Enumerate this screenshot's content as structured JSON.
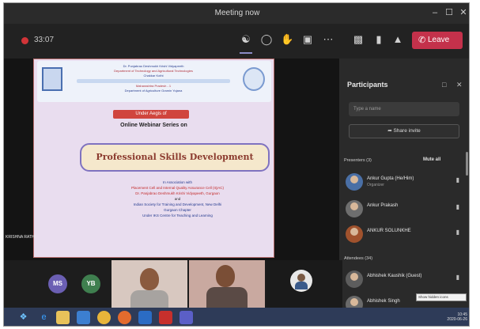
{
  "window": {
    "title": "Meeting now",
    "controls": [
      "–",
      "☐",
      "✕"
    ]
  },
  "toolbar": {
    "timer": "33:07",
    "icons": [
      "people-icon",
      "chat-icon",
      "raise-hand-icon",
      "rooms-icon",
      "more-icon",
      "camera-icon",
      "mic-icon",
      "share-icon"
    ],
    "leave_label": "Leave"
  },
  "slide": {
    "header_lines": [
      "Dr. Punjabrao Deshmukh Krishi Vidyapeeth",
      "Department of Technology and Agricultural Technologies",
      "Chakkar Kothi",
      "Maharashtra Pradesh - 1",
      "Department of Agriculture Gramin Yojana"
    ],
    "banner": "Under Aegis of",
    "series_title": "Online Webinar Series on",
    "main_title": "Professional Skills Development",
    "assoc_lines": [
      "In Association with",
      "Placement Cell and Internal Quality Assurance Cell (IQAC)",
      "Dr. Panjabrao Deshmukh Krishi Vidyapeeth, Gurgaon",
      "and",
      "Indian Society for Training and Development, New Delhi",
      "Gurgaon Chapter",
      "Under IKS Centre for Teaching and Learning"
    ],
    "speaker_label": "KRISHNA RATHI"
  },
  "participants": {
    "title": "Participants",
    "invite_placeholder": "Type a name",
    "share_invite_label": "Share invite",
    "presenters_section": "Presenters (3)",
    "mute_all_label": "Mute all",
    "attendees_section": "Attendees (34)",
    "people": [
      {
        "name": "Ankur Gupta (He/Him)",
        "role": "Organizer"
      },
      {
        "name": "Ankur Prakash",
        "role": ""
      },
      {
        "name": "ANKUR SOLUNKHE",
        "role": ""
      },
      {
        "name": "Abhishek Kaushik (Guest)",
        "role": ""
      },
      {
        "name": "Abhishek Singh",
        "role": ""
      }
    ]
  },
  "strip": {
    "avatars": [
      {
        "initials": "MS",
        "color": "#6b5fb3"
      },
      {
        "initials": "YB",
        "color": "#3f7f4f"
      }
    ]
  },
  "taskbar": {
    "apps": [
      "start-icon",
      "ie-icon",
      "explorer-icon",
      "store-icon",
      "chrome-icon",
      "firefox-icon",
      "outlook-icon",
      "acrobat-icon",
      "teams-icon"
    ],
    "time": "10:45",
    "date": "2020-06-26",
    "tooltip": "Show hidden icons"
  },
  "colors": {
    "leave": "#c4314b",
    "accent": "#8b8cc7",
    "taskbar": "#2e3b58"
  }
}
